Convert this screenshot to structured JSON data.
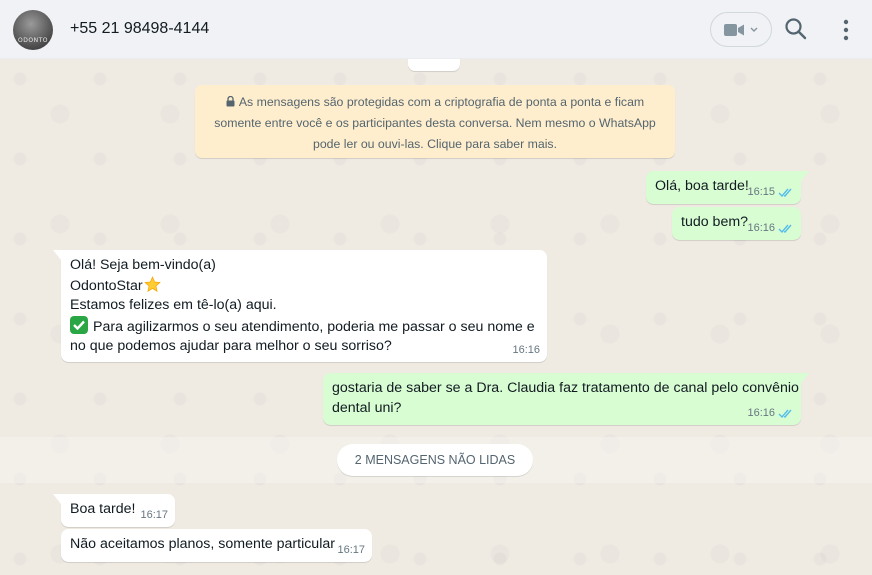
{
  "header": {
    "contact_name": "+55 21 98498-4144",
    "avatar_text": "ODONTO"
  },
  "encryption_notice": {
    "line1": "As mensagens são protegidas com a criptografia de ponta a ponta e ficam",
    "line2": "somente entre você e os participantes desta conversa. Nem mesmo o WhatsApp",
    "line3": "pode ler ou ouvi-las. Clique para saber mais."
  },
  "messages": [
    {
      "direction": "out",
      "text": "Olá, boa tarde!",
      "time": "16:15",
      "status": "read"
    },
    {
      "direction": "out",
      "text": "tudo bem?",
      "time": "16:16",
      "status": "read"
    },
    {
      "direction": "in",
      "lines": [
        "Olá! Seja bem-vindo(a)",
        "OdontoStar",
        "Estamos felizes em tê-lo(a) aqui.",
        "Para agilizarmos o seu atendimento, poderia me passar o seu nome e",
        "no que podemos ajudar para melhor o seu sorriso?"
      ],
      "time": "16:16"
    },
    {
      "direction": "out",
      "lines": [
        "gostaria de saber se a Dra. Claudia faz tratamento de canal pelo convênio",
        "dental uni?"
      ],
      "time": "16:16",
      "status": "read"
    },
    {
      "direction": "in",
      "text": "Boa tarde!",
      "time": "16:17"
    },
    {
      "direction": "in",
      "text": "Não aceitamos planos, somente particular",
      "time": "16:17"
    }
  ],
  "unread_label": "2 MENSAGENS NÃO LIDAS",
  "colors": {
    "outgoing_bubble": "#d9fdd3",
    "incoming_bubble": "#ffffff",
    "read_ticks": "#53bdeb",
    "encryption_bg": "#ffeecd",
    "chat_bg": "#efeae2"
  },
  "icons": {
    "video": "video-camera-icon",
    "search": "search-icon",
    "menu": "more-vertical-icon",
    "lock": "lock-icon",
    "read": "double-check-icon"
  }
}
